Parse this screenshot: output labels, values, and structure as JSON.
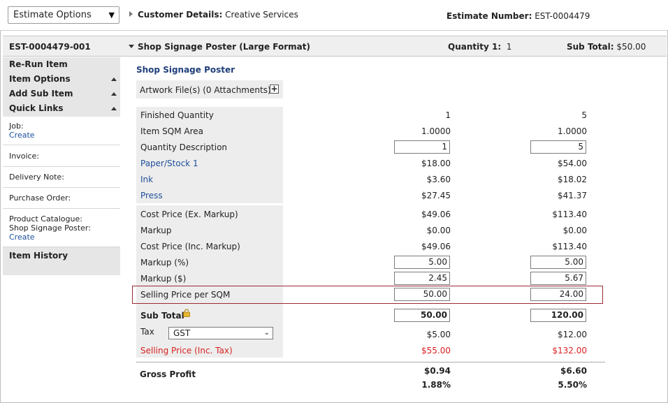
{
  "topbar": {
    "estimate_options": "Estimate Options",
    "customer_label": "Customer Details:",
    "customer_value": "Creative Services",
    "estimate_number_label": "Estimate Number:",
    "estimate_number_value": "EST-0004479"
  },
  "item_header": {
    "code": "EST-0004479-001",
    "name": "Shop Signage Poster (Large Format)",
    "quantity_label": "Quantity 1:",
    "quantity_value": "1",
    "subtotal_label": "Sub Total:",
    "subtotal_value": "$50.00"
  },
  "sidebar": {
    "rerun": "Re-Run Item",
    "item_options": "Item Options",
    "add_sub_item": "Add Sub Item",
    "quick_links": "Quick Links",
    "job_label": "Job:",
    "job_link": "Create",
    "invoice": "Invoice:",
    "delivery_note": "Delivery Note:",
    "purchase_order": "Purchase Order:",
    "product_catalogue": "Product Catalogue:",
    "product_name": "Shop Signage Poster:",
    "product_link": "Create",
    "item_history": "Item History"
  },
  "main": {
    "section_title": "Shop Signage Poster",
    "artwork_label": "Artwork File(s) (0 Attachments)",
    "artwork_add": "+",
    "rows": {
      "finished_quantity": {
        "label": "Finished Quantity",
        "v1": "1",
        "v2": "5"
      },
      "item_sqm_area": {
        "label": "Item SQM Area",
        "v1": "1.0000",
        "v2": "1.0000"
      },
      "quantity_description": {
        "label": "Quantity Description",
        "v1": "1",
        "v2": "5"
      },
      "paper_stock": {
        "label": "Paper/Stock 1",
        "v1": "$18.00",
        "v2": "$54.00"
      },
      "ink": {
        "label": "Ink",
        "v1": "$3.60",
        "v2": "$18.02"
      },
      "press": {
        "label": "Press",
        "v1": "$27.45",
        "v2": "$41.37"
      },
      "cost_ex": {
        "label": "Cost Price (Ex. Markup)",
        "v1": "$49.06",
        "v2": "$113.40"
      },
      "markup": {
        "label": "Markup",
        "v1": "$0.00",
        "v2": "$0.00"
      },
      "cost_inc": {
        "label": "Cost Price (Inc. Markup)",
        "v1": "$49.06",
        "v2": "$113.40"
      },
      "markup_pct": {
        "label": "Markup (%)",
        "v1": "5.00",
        "v2": "5.00"
      },
      "markup_dollar": {
        "label": "Markup ($)",
        "v1": "2.45",
        "v2": "5.67"
      },
      "selling_sqm": {
        "label": "Selling Price per SQM",
        "v1": "50.00",
        "v2": "24.00"
      },
      "sub_total": {
        "label": "Sub Total",
        "v1": "50.00",
        "v2": "120.00"
      },
      "tax": {
        "label": "Tax",
        "selected": "GST",
        "v1": "$5.00",
        "v2": "$12.00"
      },
      "selling_inc_tax": {
        "label": "Selling Price (Inc. Tax)",
        "v1": "$55.00",
        "v2": "$132.00"
      }
    },
    "gross_profit": {
      "label": "Gross Profit",
      "v1_amount": "$0.94",
      "v2_amount": "$6.60",
      "v1_pct": "1.88%",
      "v2_pct": "5.50%"
    }
  },
  "colors": {
    "link_blue": "#1a4f9c",
    "section_title": "#1f3e7a",
    "red_text": "#d82222",
    "highlight_border": "#9b2a33",
    "panel_grey": "#ededed"
  }
}
